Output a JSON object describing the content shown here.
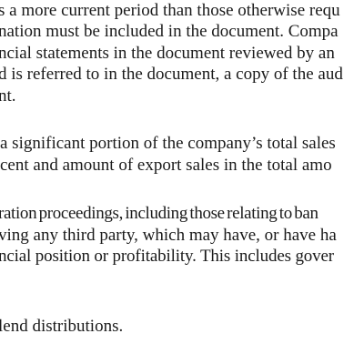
{
  "document": {
    "lines": [
      "s a more current period than those otherwise requ",
      "nation must be included in the document. Compa",
      "ncial statements in the document reviewed by an",
      "d is referred to in the document, a copy of the aud",
      "nt.",
      "a significant portion of the company’s total sales",
      "cent and amount of export sales in the total amo",
      "ration proceedings, including those relating to ban",
      "ving any third party, which may have, or have ha",
      "ncial position or profitability. This includes gover",
      "lend distributions."
    ]
  }
}
